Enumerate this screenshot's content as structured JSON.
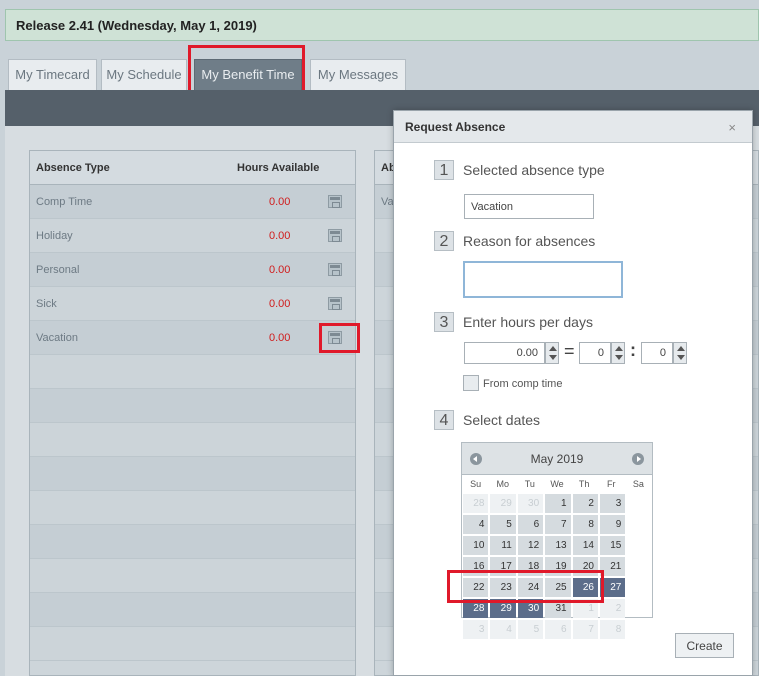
{
  "banner": {
    "text": "Release 2.41 (Wednesday, May 1, 2019)"
  },
  "tabs": [
    {
      "label": "My Timecard"
    },
    {
      "label": "My Schedule"
    },
    {
      "label": "My Benefit Time"
    },
    {
      "label": "My Messages"
    }
  ],
  "absence_table": {
    "col_type": "Absence Type",
    "col_hours": "Hours Available",
    "rows": [
      {
        "type": "Comp Time",
        "hours": "0.00"
      },
      {
        "type": "Holiday",
        "hours": "0.00"
      },
      {
        "type": "Personal",
        "hours": "0.00"
      },
      {
        "type": "Sick",
        "hours": "0.00"
      },
      {
        "type": "Vacation",
        "hours": "0.00"
      }
    ]
  },
  "second_panel": {
    "header": "Ab",
    "first_row": "Va"
  },
  "dialog": {
    "title": "Request Absence",
    "close": "×",
    "step1": {
      "num": "1",
      "label": "Selected absence type",
      "value": "Vacation"
    },
    "step2": {
      "num": "2",
      "label": "Reason for absences",
      "value": ""
    },
    "step3": {
      "num": "3",
      "label": "Enter hours per days",
      "hours": "0.00",
      "hh": "0",
      "mm": "0",
      "eq": "=",
      "colon": ":",
      "comp_label": "From comp time"
    },
    "step4": {
      "num": "4",
      "label": "Select dates"
    },
    "create": "Create"
  },
  "calendar": {
    "month": "May 2019",
    "dow": [
      "Su",
      "Mo",
      "Tu",
      "We",
      "Th",
      "Fr",
      "Sa"
    ],
    "days": [
      {
        "d": "28",
        "s": "out"
      },
      {
        "d": "29",
        "s": "out"
      },
      {
        "d": "30",
        "s": "out"
      },
      {
        "d": "1",
        "s": ""
      },
      {
        "d": "2",
        "s": ""
      },
      {
        "d": "3",
        "s": ""
      },
      {
        "d": "4",
        "s": ""
      },
      {
        "d": "5",
        "s": ""
      },
      {
        "d": "6",
        "s": ""
      },
      {
        "d": "7",
        "s": ""
      },
      {
        "d": "8",
        "s": ""
      },
      {
        "d": "9",
        "s": ""
      },
      {
        "d": "10",
        "s": ""
      },
      {
        "d": "11",
        "s": ""
      },
      {
        "d": "12",
        "s": ""
      },
      {
        "d": "13",
        "s": ""
      },
      {
        "d": "14",
        "s": ""
      },
      {
        "d": "15",
        "s": ""
      },
      {
        "d": "16",
        "s": ""
      },
      {
        "d": "17",
        "s": ""
      },
      {
        "d": "18",
        "s": ""
      },
      {
        "d": "19",
        "s": ""
      },
      {
        "d": "20",
        "s": ""
      },
      {
        "d": "21",
        "s": ""
      },
      {
        "d": "22",
        "s": ""
      },
      {
        "d": "23",
        "s": ""
      },
      {
        "d": "24",
        "s": ""
      },
      {
        "d": "25",
        "s": ""
      },
      {
        "d": "26",
        "s": "sel"
      },
      {
        "d": "27",
        "s": "sel"
      },
      {
        "d": "28",
        "s": "sel"
      },
      {
        "d": "29",
        "s": "sel"
      },
      {
        "d": "30",
        "s": "sel"
      },
      {
        "d": "31",
        "s": ""
      },
      {
        "d": "1",
        "s": "out"
      },
      {
        "d": "2",
        "s": "out"
      },
      {
        "d": "3",
        "s": "out"
      },
      {
        "d": "4",
        "s": "out"
      },
      {
        "d": "5",
        "s": "out"
      },
      {
        "d": "6",
        "s": "out"
      },
      {
        "d": "7",
        "s": "out"
      },
      {
        "d": "8",
        "s": "out"
      }
    ]
  },
  "colors": {
    "highlight": "#e0192a",
    "selected_day": "#5c6d8a",
    "hours_value": "#d01c1c"
  }
}
